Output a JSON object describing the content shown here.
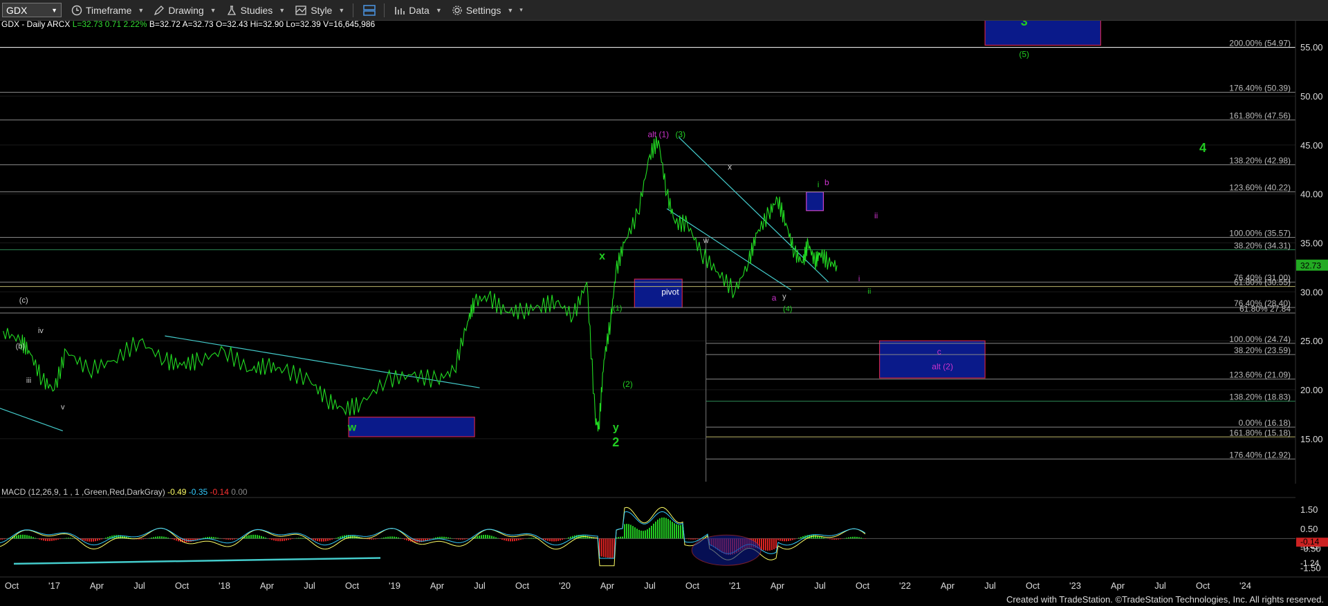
{
  "toolbar": {
    "symbol": "GDX",
    "timeframe": "Timeframe",
    "drawing": "Drawing",
    "studies": "Studies",
    "style": "Style",
    "data": "Data",
    "settings": "Settings"
  },
  "chart_data": {
    "type": "line",
    "header": {
      "name": "GDX - Daily",
      "exchange": "ARCX",
      "last": "L=32.73",
      "change": "0.71",
      "change_pct": "2.22%",
      "bid": "B=32.72",
      "ask": "A=32.73",
      "open": "O=32.43",
      "high": "Hi=32.90",
      "low": "Lo=32.39",
      "volume": "V=16,645,986"
    },
    "price_axis": {
      "ticks": [
        "55.00",
        "50.00",
        "45.00",
        "40.00",
        "35.00",
        "30.00",
        "25.00",
        "20.00",
        "15.00"
      ],
      "ylim": [
        10.4,
        57.7
      ],
      "last_price_label": "32.73"
    },
    "x_axis": {
      "ticks": [
        "Oct",
        "'17",
        "Apr",
        "Jul",
        "Oct",
        "'18",
        "Apr",
        "Jul",
        "Oct",
        "'19",
        "Apr",
        "Jul",
        "Oct",
        "'20",
        "Apr",
        "Jul",
        "Oct",
        "'21",
        "Apr",
        "Jul",
        "Oct",
        "'22",
        "Apr",
        "Jul",
        "Oct",
        "'23",
        "Apr",
        "Jul",
        "Oct",
        "'24"
      ],
      "tick_x": [
        0,
        0.25,
        0.5,
        0.75,
        1,
        1.25,
        1.5,
        1.75,
        2,
        2.25,
        2.5,
        2.75,
        3,
        3.25,
        3.5,
        3.75,
        4,
        4.25,
        4.5,
        4.75,
        5,
        5.25,
        5.5,
        5.75,
        6,
        6.25,
        6.5,
        6.75,
        7,
        7.25
      ],
      "x_unit": "years since Oct 2016"
    },
    "price_series": {
      "x": [
        -0.05,
        0.05,
        0.1,
        0.18,
        0.25,
        0.32,
        0.45,
        0.6,
        0.75,
        0.9,
        1.0,
        1.1,
        1.25,
        1.4,
        1.5,
        1.6,
        1.75,
        1.85,
        1.95,
        2.05,
        2.2,
        2.35,
        2.5,
        2.6,
        2.68,
        2.72,
        2.8,
        2.9,
        3.0,
        3.1,
        3.2,
        3.3,
        3.38,
        3.43,
        3.45,
        3.48,
        3.52,
        3.55,
        3.6,
        3.68,
        3.75,
        3.8,
        3.85,
        3.9,
        3.97,
        4.05,
        4.15,
        4.25,
        4.33,
        4.38,
        4.45,
        4.5,
        4.55,
        4.6,
        4.65,
        4.68,
        4.72,
        4.75,
        4.8,
        4.85
      ],
      "y": [
        26,
        25,
        24,
        21,
        20,
        24,
        22,
        23,
        25,
        23,
        22.5,
        23,
        24,
        22,
        22.5,
        22,
        21,
        19,
        18,
        18.5,
        21,
        21.5,
        21,
        22,
        27,
        29,
        29.5,
        28,
        28,
        28.5,
        29,
        27.5,
        31,
        17,
        16,
        23,
        27,
        32,
        35,
        38,
        44,
        45.5,
        40,
        37,
        37,
        34,
        32,
        30,
        33,
        36,
        38,
        39.5,
        37,
        34,
        33,
        35,
        33,
        34,
        33,
        32.7
      ]
    },
    "fib_levels": [
      {
        "label": "200.00% (54.97)",
        "value": 54.97,
        "color": "#ffffff"
      },
      {
        "label": "176.40% (50.39)",
        "value": 50.39,
        "color": "#888888"
      },
      {
        "label": "161.80% (47.56)",
        "value": 47.56,
        "color": "#888888"
      },
      {
        "label": "138.20% (42.98)",
        "value": 42.98,
        "color": "#888888"
      },
      {
        "label": "123.60% (40.22)",
        "value": 40.22,
        "color": "#888888"
      },
      {
        "label": "100.00% (35.57)",
        "value": 35.57,
        "color": "#888888"
      },
      {
        "label": "38.20% (34.31)",
        "value": 34.31,
        "color": "#2e8b57"
      },
      {
        "label": "76.40% (31.00)",
        "value": 31.0,
        "color": "#888888"
      },
      {
        "label": "61.80% (30.55)",
        "value": 30.55,
        "color": "#bdb76b"
      },
      {
        "label": "76.40% (28.40)",
        "value": 28.4,
        "color": "#888888"
      },
      {
        "label": "61.80% 27.84",
        "value": 27.84,
        "color": "#888888"
      },
      {
        "label": "100.00% (24.74)",
        "value": 24.74,
        "color": "#888888"
      },
      {
        "label": "38.20% (23.59)",
        "value": 23.59,
        "color": "#888888"
      },
      {
        "label": "123.60% (21.09)",
        "value": 21.09,
        "color": "#888888"
      },
      {
        "label": "138.20% (18.83)",
        "value": 18.83,
        "color": "#2e8b57"
      },
      {
        "label": "0.00% (16.18)",
        "value": 16.18,
        "color": "#888888"
      },
      {
        "label": "161.80% (15.18)",
        "value": 15.18,
        "color": "#bdb76b"
      },
      {
        "label": "176.40% (12.92)",
        "value": 12.92,
        "color": "#888888"
      }
    ],
    "annotations": [
      {
        "text": "3",
        "x": 5.95,
        "y": 57.2,
        "color": "#22cc22",
        "size": 18
      },
      {
        "text": "(5)",
        "x": 5.95,
        "y": 54.0,
        "color": "#22cc22",
        "size": 12
      },
      {
        "text": "4",
        "x": 7.0,
        "y": 44.3,
        "color": "#22cc22",
        "size": 18
      },
      {
        "text": "alt (1)",
        "x": 3.8,
        "y": 45.8,
        "color": "#cc33cc",
        "size": 12
      },
      {
        "text": "(3)",
        "x": 3.93,
        "y": 45.8,
        "color": "#22cc22",
        "size": 12
      },
      {
        "text": "x",
        "x": 4.22,
        "y": 42.5,
        "color": "#cccccc",
        "size": 12
      },
      {
        "text": "i",
        "x": 4.74,
        "y": 40.7,
        "color": "#22cc22",
        "size": 12
      },
      {
        "text": "b",
        "x": 4.79,
        "y": 40.9,
        "color": "#cc33cc",
        "size": 12
      },
      {
        "text": "ii",
        "x": 5.08,
        "y": 37.5,
        "color": "#cc33cc",
        "size": 12
      },
      {
        "text": "w",
        "x": 4.08,
        "y": 35.0,
        "color": "#cccccc",
        "size": 11
      },
      {
        "text": "x",
        "x": 3.47,
        "y": 33.3,
        "color": "#22cc22",
        "size": 16
      },
      {
        "text": "pivot",
        "x": 3.87,
        "y": 29.7,
        "color": "#ffffff",
        "size": 12
      },
      {
        "text": "a",
        "x": 4.48,
        "y": 29.1,
        "color": "#cc33cc",
        "size": 12
      },
      {
        "text": "y",
        "x": 4.54,
        "y": 29.3,
        "color": "#cccccc",
        "size": 11
      },
      {
        "text": "(4)",
        "x": 4.56,
        "y": 28.0,
        "color": "#22cc22",
        "size": 11
      },
      {
        "text": "i",
        "x": 4.98,
        "y": 31.1,
        "color": "#cc33cc",
        "size": 11
      },
      {
        "text": "ii",
        "x": 5.04,
        "y": 29.8,
        "color": "#22cc22",
        "size": 11
      },
      {
        "text": "(1)",
        "x": 3.56,
        "y": 28.1,
        "color": "#22cc22",
        "size": 11
      },
      {
        "text": "(2)",
        "x": 3.62,
        "y": 20.3,
        "color": "#22cc22",
        "size": 12
      },
      {
        "text": "y",
        "x": 3.55,
        "y": 15.8,
        "color": "#22cc22",
        "size": 16
      },
      {
        "text": "2",
        "x": 3.55,
        "y": 14.2,
        "color": "#22cc22",
        "size": 18
      },
      {
        "text": "w",
        "x": 2.0,
        "y": 15.8,
        "color": "#22cc22",
        "size": 16
      },
      {
        "text": "c",
        "x": 5.45,
        "y": 23.6,
        "color": "#cc33cc",
        "size": 12
      },
      {
        "text": "alt (2)",
        "x": 5.47,
        "y": 22.1,
        "color": "#cc33cc",
        "size": 12
      },
      {
        "text": "(c)",
        "x": 0.07,
        "y": 28.9,
        "color": "#cccccc",
        "size": 11
      },
      {
        "text": "iv",
        "x": 0.17,
        "y": 25.8,
        "color": "#cccccc",
        "size": 11
      },
      {
        "text": "(b)",
        "x": 0.05,
        "y": 24.2,
        "color": "#cccccc",
        "size": 11
      },
      {
        "text": "iii",
        "x": 0.1,
        "y": 20.7,
        "color": "#cccccc",
        "size": 11
      },
      {
        "text": "v",
        "x": 0.3,
        "y": 18.0,
        "color": "#cccccc",
        "size": 11
      }
    ],
    "macd": {
      "label": "MACD (12,26,9, 1 , 1 ,Green,Red,DarkGray)",
      "values": [
        "-0.49",
        "-0.35",
        "-0.14",
        "0.00"
      ],
      "ticks": [
        "1.50",
        "0.50",
        "-0.50",
        "-1.50"
      ],
      "right_labels": [
        "-0.35",
        "-0.49",
        "-0.14",
        "-1.24"
      ],
      "ylim": [
        -1.8,
        2.0
      ]
    }
  },
  "footer": "Created with TradeStation. ©TradeStation Technologies, Inc. All rights reserved."
}
